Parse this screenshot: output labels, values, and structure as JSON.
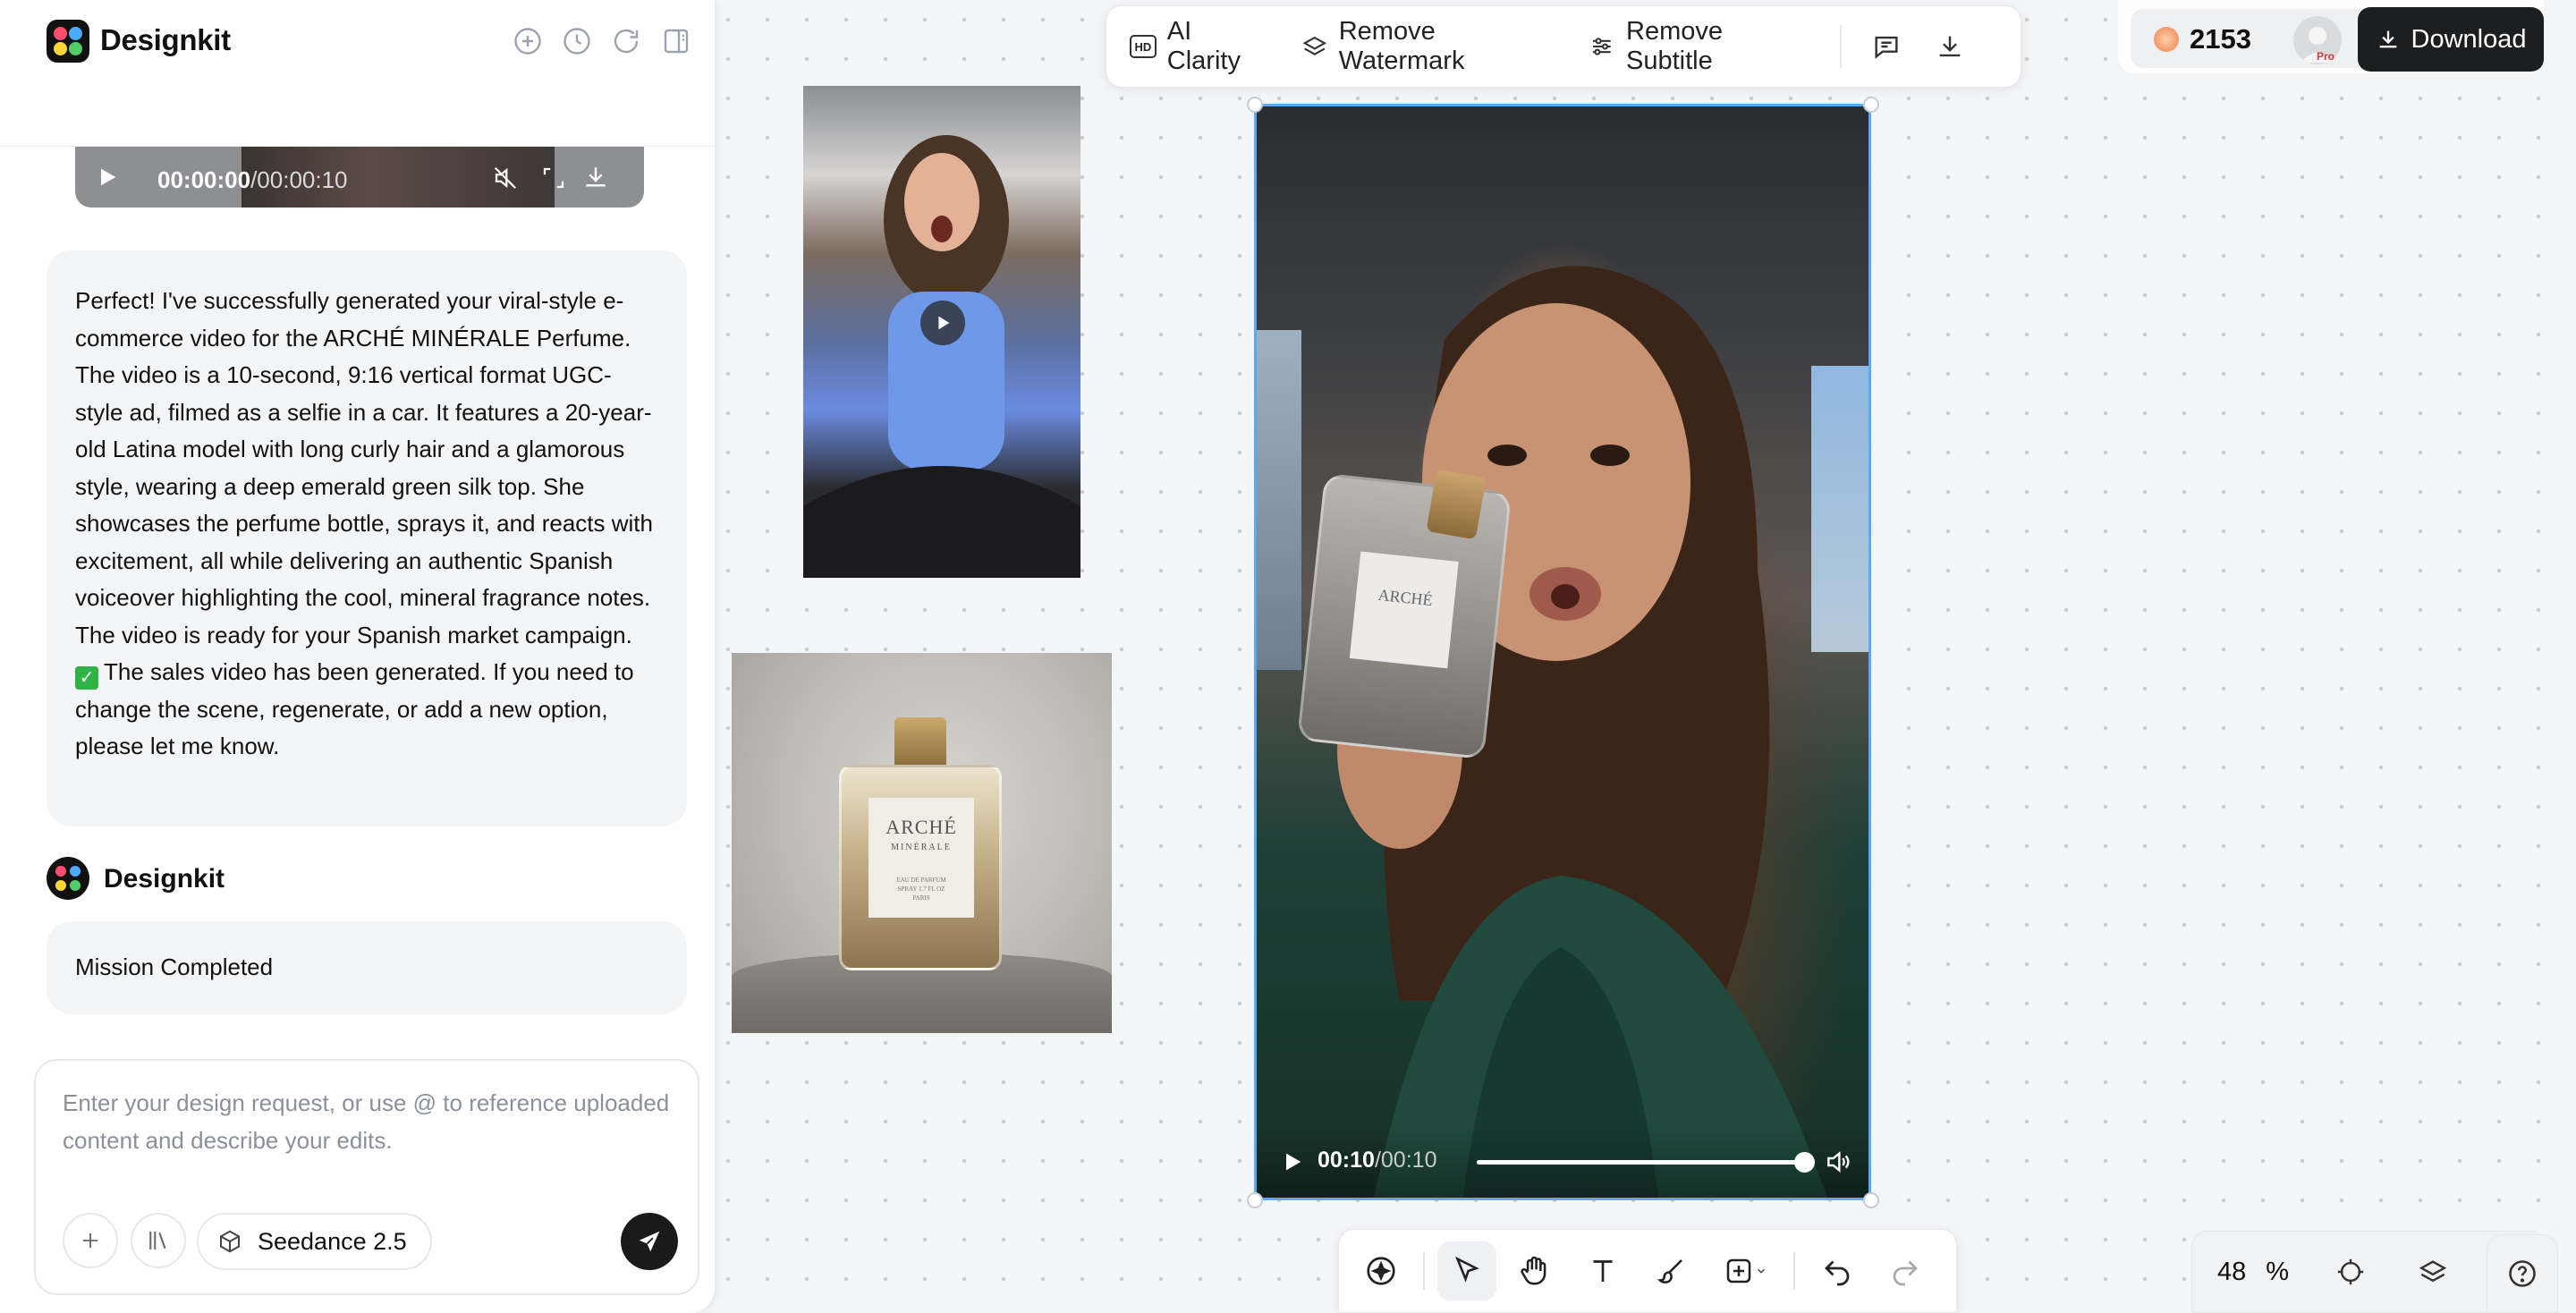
{
  "app": {
    "brand": "Designkit",
    "header_icons": [
      "new-chat-icon",
      "history-icon",
      "refresh-icon",
      "sidebar-toggle-icon"
    ]
  },
  "chat": {
    "audio_player": {
      "current_time": "00:00:00",
      "total_time": "/00:00:10"
    },
    "assistant_message": {
      "paragraph": "Perfect! I've successfully generated your viral-style e-commerce video for the ARCHÉ MINÉRALE Perfume. The video is a 10-second, 9:16 vertical format UGC-style ad, filmed as a selfie in a car. It features a 20-year-old Latina model with long curly hair and a glamorous style, wearing a deep emerald green silk top. She showcases the perfume bottle, sprays it, and reacts with excitement, all while delivering an authentic Spanish voiceover highlighting the cool, mineral fragrance notes. The video is ready for your Spanish market campaign.",
      "status_line": "The sales video has been generated. If you need to change the scene, regenerate, or add a new option, please let me know."
    },
    "agent_name": "Designkit",
    "status_message": "Mission Completed",
    "composer": {
      "placeholder": "Enter your design request, or use @ to reference uploaded content and describe your edits.",
      "value": "",
      "model_label": "Seedance 2.5"
    }
  },
  "canvas": {
    "perfume_label": {
      "name": "ARCHÉ",
      "sub": "MINÉRALE",
      "small": "EAU DE PARFUM\nSPRAY 1.7 FL OZ\nPARIS"
    },
    "bottle_label": "ARCHÉ",
    "video": {
      "current_time": "00:10",
      "separator": "/",
      "total_time": "00:10",
      "progress": 1.0
    }
  },
  "top_toolbar": {
    "ai_clarity": "AI Clarity",
    "ai_clarity_badge": "HD",
    "remove_watermark": "Remove Watermark",
    "remove_subtitle": "Remove Subtitle"
  },
  "account": {
    "credits": "2153",
    "plan_badge": "Pro",
    "download_label": "Download"
  },
  "zoom": {
    "value": "48",
    "unit": "%"
  },
  "colors": {
    "selection": "#5aa9f5",
    "primary_button": "#1d1e20",
    "check_green": "#2fb344"
  }
}
